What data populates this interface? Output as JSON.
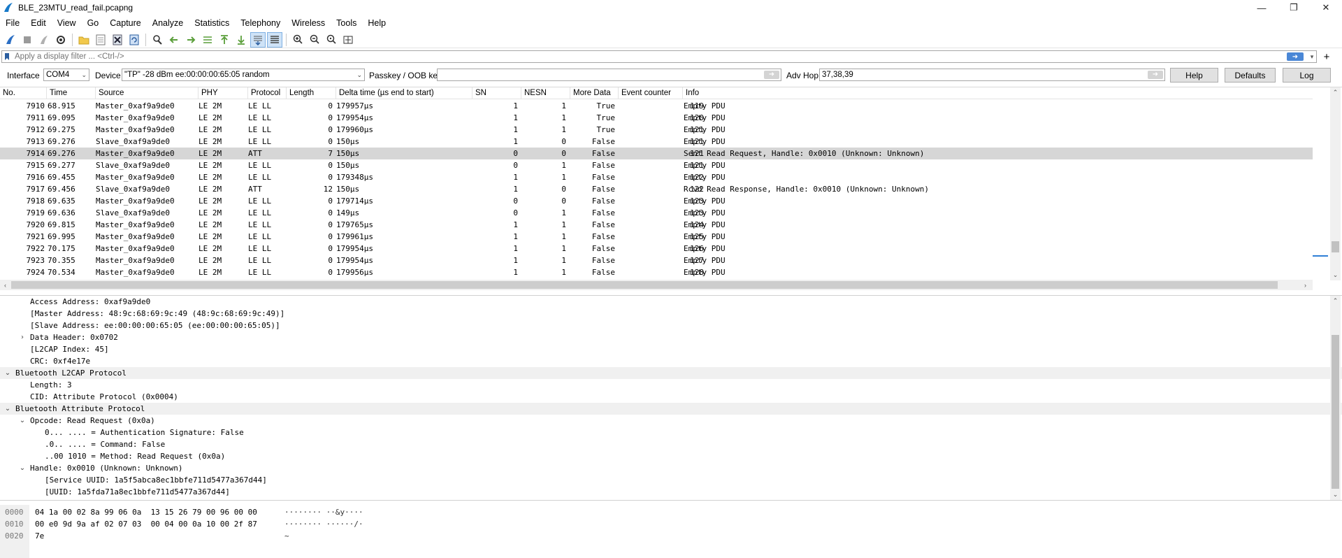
{
  "window": {
    "title": "BLE_23MTU_read_fail.pcapng",
    "minimize": "—",
    "maximize": "❐",
    "close": "✕"
  },
  "menu": [
    "File",
    "Edit",
    "View",
    "Go",
    "Capture",
    "Analyze",
    "Statistics",
    "Telephony",
    "Wireless",
    "Tools",
    "Help"
  ],
  "filter": {
    "placeholder": "Apply a display filter ... <Ctrl-/>",
    "plus": "+"
  },
  "interface_bar": {
    "interface_label": "Interface",
    "interface_value": "COM4",
    "device_label": "Device",
    "device_value": "\"TP\" -28 dBm  ee:00:00:00:65:05  random",
    "passkey_label": "Passkey / OOB key",
    "passkey_value": "",
    "advhop_label": "Adv Hop",
    "advhop_value": "37,38,39",
    "help_label": "Help",
    "defaults_label": "Defaults",
    "log_label": "Log"
  },
  "packet_list": {
    "columns": [
      "No.",
      "Time",
      "Source",
      "PHY",
      "Protocol",
      "Length",
      "Delta time (µs end to start)",
      "SN",
      "NESN",
      "More Data",
      "Event counter",
      "Info"
    ],
    "selected_index": 4,
    "rows": [
      {
        "no": "7910",
        "time": "68.915",
        "src": "Master_0xaf9a9de0",
        "phy": "LE 2M",
        "proto": "LE LL",
        "len": "0",
        "delta": "179957µs",
        "sn": "1",
        "nesn": "1",
        "md": "True",
        "ev": "119",
        "info": "Empty PDU"
      },
      {
        "no": "7911",
        "time": "69.095",
        "src": "Master_0xaf9a9de0",
        "phy": "LE 2M",
        "proto": "LE LL",
        "len": "0",
        "delta": "179954µs",
        "sn": "1",
        "nesn": "1",
        "md": "True",
        "ev": "120",
        "info": "Empty PDU"
      },
      {
        "no": "7912",
        "time": "69.275",
        "src": "Master_0xaf9a9de0",
        "phy": "LE 2M",
        "proto": "LE LL",
        "len": "0",
        "delta": "179960µs",
        "sn": "1",
        "nesn": "1",
        "md": "True",
        "ev": "121",
        "info": "Empty PDU"
      },
      {
        "no": "7913",
        "time": "69.276",
        "src": "Slave_0xaf9a9de0",
        "phy": "LE 2M",
        "proto": "LE LL",
        "len": "0",
        "delta": "150µs",
        "sn": "1",
        "nesn": "0",
        "md": "False",
        "ev": "121",
        "info": "Empty PDU"
      },
      {
        "no": "7914",
        "time": "69.276",
        "src": "Master_0xaf9a9de0",
        "phy": "LE 2M",
        "proto": "ATT",
        "len": "7",
        "delta": "150µs",
        "sn": "0",
        "nesn": "0",
        "md": "False",
        "ev": "121",
        "info": "Sent Read Request, Handle: 0x0010 (Unknown: Unknown)"
      },
      {
        "no": "7915",
        "time": "69.277",
        "src": "Slave_0xaf9a9de0",
        "phy": "LE 2M",
        "proto": "LE LL",
        "len": "0",
        "delta": "150µs",
        "sn": "0",
        "nesn": "1",
        "md": "False",
        "ev": "121",
        "info": "Empty PDU"
      },
      {
        "no": "7916",
        "time": "69.455",
        "src": "Master_0xaf9a9de0",
        "phy": "LE 2M",
        "proto": "LE LL",
        "len": "0",
        "delta": "179348µs",
        "sn": "1",
        "nesn": "1",
        "md": "False",
        "ev": "122",
        "info": "Empty PDU"
      },
      {
        "no": "7917",
        "time": "69.456",
        "src": "Slave_0xaf9a9de0",
        "phy": "LE 2M",
        "proto": "ATT",
        "len": "12",
        "delta": "150µs",
        "sn": "1",
        "nesn": "0",
        "md": "False",
        "ev": "122",
        "info": "Rcvd Read Response, Handle: 0x0010 (Unknown: Unknown)"
      },
      {
        "no": "7918",
        "time": "69.635",
        "src": "Master_0xaf9a9de0",
        "phy": "LE 2M",
        "proto": "LE LL",
        "len": "0",
        "delta": "179714µs",
        "sn": "0",
        "nesn": "0",
        "md": "False",
        "ev": "123",
        "info": "Empty PDU"
      },
      {
        "no": "7919",
        "time": "69.636",
        "src": "Slave_0xaf9a9de0",
        "phy": "LE 2M",
        "proto": "LE LL",
        "len": "0",
        "delta": "149µs",
        "sn": "0",
        "nesn": "1",
        "md": "False",
        "ev": "123",
        "info": "Empty PDU"
      },
      {
        "no": "7920",
        "time": "69.815",
        "src": "Master_0xaf9a9de0",
        "phy": "LE 2M",
        "proto": "LE LL",
        "len": "0",
        "delta": "179765µs",
        "sn": "1",
        "nesn": "1",
        "md": "False",
        "ev": "124",
        "info": "Empty PDU"
      },
      {
        "no": "7921",
        "time": "69.995",
        "src": "Master_0xaf9a9de0",
        "phy": "LE 2M",
        "proto": "LE LL",
        "len": "0",
        "delta": "179961µs",
        "sn": "1",
        "nesn": "1",
        "md": "False",
        "ev": "125",
        "info": "Empty PDU"
      },
      {
        "no": "7922",
        "time": "70.175",
        "src": "Master_0xaf9a9de0",
        "phy": "LE 2M",
        "proto": "LE LL",
        "len": "0",
        "delta": "179954µs",
        "sn": "1",
        "nesn": "1",
        "md": "False",
        "ev": "126",
        "info": "Empty PDU"
      },
      {
        "no": "7923",
        "time": "70.355",
        "src": "Master_0xaf9a9de0",
        "phy": "LE 2M",
        "proto": "LE LL",
        "len": "0",
        "delta": "179954µs",
        "sn": "1",
        "nesn": "1",
        "md": "False",
        "ev": "127",
        "info": "Empty PDU"
      },
      {
        "no": "7924",
        "time": "70.534",
        "src": "Master_0xaf9a9de0",
        "phy": "LE 2M",
        "proto": "LE LL",
        "len": "0",
        "delta": "179956µs",
        "sn": "1",
        "nesn": "1",
        "md": "False",
        "ev": "128",
        "info": "Empty PDU"
      }
    ]
  },
  "details": [
    {
      "level": 2,
      "toggle": "",
      "header": false,
      "text": "Access Address: 0xaf9a9de0"
    },
    {
      "level": 2,
      "toggle": "",
      "header": false,
      "text": "[Master Address: 48:9c:68:69:9c:49 (48:9c:68:69:9c:49)]"
    },
    {
      "level": 2,
      "toggle": "",
      "header": false,
      "text": "[Slave Address: ee:00:00:00:65:05 (ee:00:00:00:65:05)]"
    },
    {
      "level": 2,
      "toggle": "›",
      "header": false,
      "text": "Data Header: 0x0702"
    },
    {
      "level": 2,
      "toggle": "",
      "header": false,
      "text": "[L2CAP Index: 45]"
    },
    {
      "level": 2,
      "toggle": "",
      "header": false,
      "text": "CRC: 0xf4e17e"
    },
    {
      "level": 1,
      "toggle": "⌄",
      "header": true,
      "text": "Bluetooth L2CAP Protocol"
    },
    {
      "level": 2,
      "toggle": "",
      "header": false,
      "text": "Length: 3"
    },
    {
      "level": 2,
      "toggle": "",
      "header": false,
      "text": "CID: Attribute Protocol (0x0004)"
    },
    {
      "level": 1,
      "toggle": "⌄",
      "header": true,
      "text": "Bluetooth Attribute Protocol"
    },
    {
      "level": 2,
      "toggle": "⌄",
      "header": false,
      "text": "Opcode: Read Request (0x0a)"
    },
    {
      "level": 3,
      "toggle": "",
      "header": false,
      "text": "0... .... = Authentication Signature: False"
    },
    {
      "level": 3,
      "toggle": "",
      "header": false,
      "text": ".0.. .... = Command: False"
    },
    {
      "level": 3,
      "toggle": "",
      "header": false,
      "text": "..00 1010 = Method: Read Request (0x0a)"
    },
    {
      "level": 2,
      "toggle": "⌄",
      "header": false,
      "text": "Handle: 0x0010 (Unknown: Unknown)"
    },
    {
      "level": 3,
      "toggle": "",
      "header": false,
      "text": "[Service UUID: 1a5f5abca8ec1bbfe711d5477a367d44]"
    },
    {
      "level": 3,
      "toggle": "",
      "header": false,
      "text": "[UUID: 1a5fda71a8ec1bbfe711d5477a367d44]"
    }
  ],
  "hex": [
    {
      "offset": "0000",
      "bytes": "04 1a 00 02 8a 99 06 0a  13 15 26 79 00 96 00 00",
      "ascii": "········ ··&y····"
    },
    {
      "offset": "0010",
      "bytes": "00 e0 9d 9a af 02 07 03  00 04 00 0a 10 00 2f 87",
      "ascii": "········ ······/·"
    },
    {
      "offset": "0020",
      "bytes": "7e",
      "ascii": "~"
    }
  ],
  "colors": {
    "selected_row": "#d6d6d6",
    "detail_header": "#f0f0f0",
    "filter_apply": "#4a87d6"
  }
}
